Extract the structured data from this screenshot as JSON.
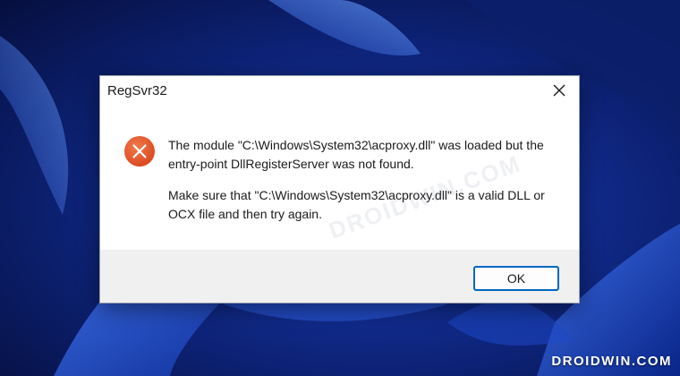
{
  "dialog": {
    "title": "RegSvr32",
    "message_line_1": "The module \"C:\\Windows\\System32\\acproxy.dll\" was loaded but the entry-point DllRegisterServer was not found.",
    "message_line_2": "Make sure that \"C:\\Windows\\System32\\acproxy.dll\" is a valid DLL or OCX file and then try again.",
    "ok_label": "OK",
    "icon": "error-x-icon",
    "close_icon": "close-icon"
  },
  "watermark": {
    "text": "DROIDWIN.COM"
  },
  "colors": {
    "error_icon": "#e2572b",
    "button_border": "#0067c0",
    "footer_bg": "#f0f0f0",
    "wallpaper_dark": "#0a1a5e",
    "wallpaper_light": "#3a6fe8"
  }
}
